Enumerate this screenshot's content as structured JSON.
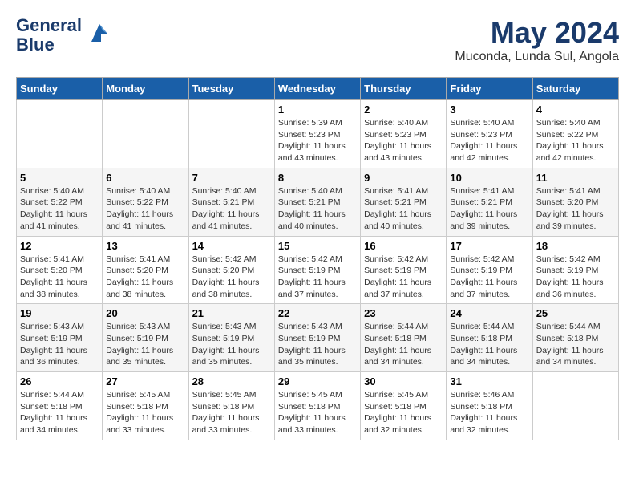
{
  "logo": {
    "line1": "General",
    "line2": "Blue"
  },
  "title": "May 2024",
  "subtitle": "Muconda, Lunda Sul, Angola",
  "weekdays": [
    "Sunday",
    "Monday",
    "Tuesday",
    "Wednesday",
    "Thursday",
    "Friday",
    "Saturday"
  ],
  "weeks": [
    [
      {
        "day": "",
        "info": ""
      },
      {
        "day": "",
        "info": ""
      },
      {
        "day": "",
        "info": ""
      },
      {
        "day": "1",
        "info": "Sunrise: 5:39 AM\nSunset: 5:23 PM\nDaylight: 11 hours and 43 minutes."
      },
      {
        "day": "2",
        "info": "Sunrise: 5:40 AM\nSunset: 5:23 PM\nDaylight: 11 hours and 43 minutes."
      },
      {
        "day": "3",
        "info": "Sunrise: 5:40 AM\nSunset: 5:23 PM\nDaylight: 11 hours and 42 minutes."
      },
      {
        "day": "4",
        "info": "Sunrise: 5:40 AM\nSunset: 5:22 PM\nDaylight: 11 hours and 42 minutes."
      }
    ],
    [
      {
        "day": "5",
        "info": "Sunrise: 5:40 AM\nSunset: 5:22 PM\nDaylight: 11 hours and 41 minutes."
      },
      {
        "day": "6",
        "info": "Sunrise: 5:40 AM\nSunset: 5:22 PM\nDaylight: 11 hours and 41 minutes."
      },
      {
        "day": "7",
        "info": "Sunrise: 5:40 AM\nSunset: 5:21 PM\nDaylight: 11 hours and 41 minutes."
      },
      {
        "day": "8",
        "info": "Sunrise: 5:40 AM\nSunset: 5:21 PM\nDaylight: 11 hours and 40 minutes."
      },
      {
        "day": "9",
        "info": "Sunrise: 5:41 AM\nSunset: 5:21 PM\nDaylight: 11 hours and 40 minutes."
      },
      {
        "day": "10",
        "info": "Sunrise: 5:41 AM\nSunset: 5:21 PM\nDaylight: 11 hours and 39 minutes."
      },
      {
        "day": "11",
        "info": "Sunrise: 5:41 AM\nSunset: 5:20 PM\nDaylight: 11 hours and 39 minutes."
      }
    ],
    [
      {
        "day": "12",
        "info": "Sunrise: 5:41 AM\nSunset: 5:20 PM\nDaylight: 11 hours and 38 minutes."
      },
      {
        "day": "13",
        "info": "Sunrise: 5:41 AM\nSunset: 5:20 PM\nDaylight: 11 hours and 38 minutes."
      },
      {
        "day": "14",
        "info": "Sunrise: 5:42 AM\nSunset: 5:20 PM\nDaylight: 11 hours and 38 minutes."
      },
      {
        "day": "15",
        "info": "Sunrise: 5:42 AM\nSunset: 5:19 PM\nDaylight: 11 hours and 37 minutes."
      },
      {
        "day": "16",
        "info": "Sunrise: 5:42 AM\nSunset: 5:19 PM\nDaylight: 11 hours and 37 minutes."
      },
      {
        "day": "17",
        "info": "Sunrise: 5:42 AM\nSunset: 5:19 PM\nDaylight: 11 hours and 37 minutes."
      },
      {
        "day": "18",
        "info": "Sunrise: 5:42 AM\nSunset: 5:19 PM\nDaylight: 11 hours and 36 minutes."
      }
    ],
    [
      {
        "day": "19",
        "info": "Sunrise: 5:43 AM\nSunset: 5:19 PM\nDaylight: 11 hours and 36 minutes."
      },
      {
        "day": "20",
        "info": "Sunrise: 5:43 AM\nSunset: 5:19 PM\nDaylight: 11 hours and 35 minutes."
      },
      {
        "day": "21",
        "info": "Sunrise: 5:43 AM\nSunset: 5:19 PM\nDaylight: 11 hours and 35 minutes."
      },
      {
        "day": "22",
        "info": "Sunrise: 5:43 AM\nSunset: 5:19 PM\nDaylight: 11 hours and 35 minutes."
      },
      {
        "day": "23",
        "info": "Sunrise: 5:44 AM\nSunset: 5:18 PM\nDaylight: 11 hours and 34 minutes."
      },
      {
        "day": "24",
        "info": "Sunrise: 5:44 AM\nSunset: 5:18 PM\nDaylight: 11 hours and 34 minutes."
      },
      {
        "day": "25",
        "info": "Sunrise: 5:44 AM\nSunset: 5:18 PM\nDaylight: 11 hours and 34 minutes."
      }
    ],
    [
      {
        "day": "26",
        "info": "Sunrise: 5:44 AM\nSunset: 5:18 PM\nDaylight: 11 hours and 34 minutes."
      },
      {
        "day": "27",
        "info": "Sunrise: 5:45 AM\nSunset: 5:18 PM\nDaylight: 11 hours and 33 minutes."
      },
      {
        "day": "28",
        "info": "Sunrise: 5:45 AM\nSunset: 5:18 PM\nDaylight: 11 hours and 33 minutes."
      },
      {
        "day": "29",
        "info": "Sunrise: 5:45 AM\nSunset: 5:18 PM\nDaylight: 11 hours and 33 minutes."
      },
      {
        "day": "30",
        "info": "Sunrise: 5:45 AM\nSunset: 5:18 PM\nDaylight: 11 hours and 32 minutes."
      },
      {
        "day": "31",
        "info": "Sunrise: 5:46 AM\nSunset: 5:18 PM\nDaylight: 11 hours and 32 minutes."
      },
      {
        "day": "",
        "info": ""
      }
    ]
  ]
}
